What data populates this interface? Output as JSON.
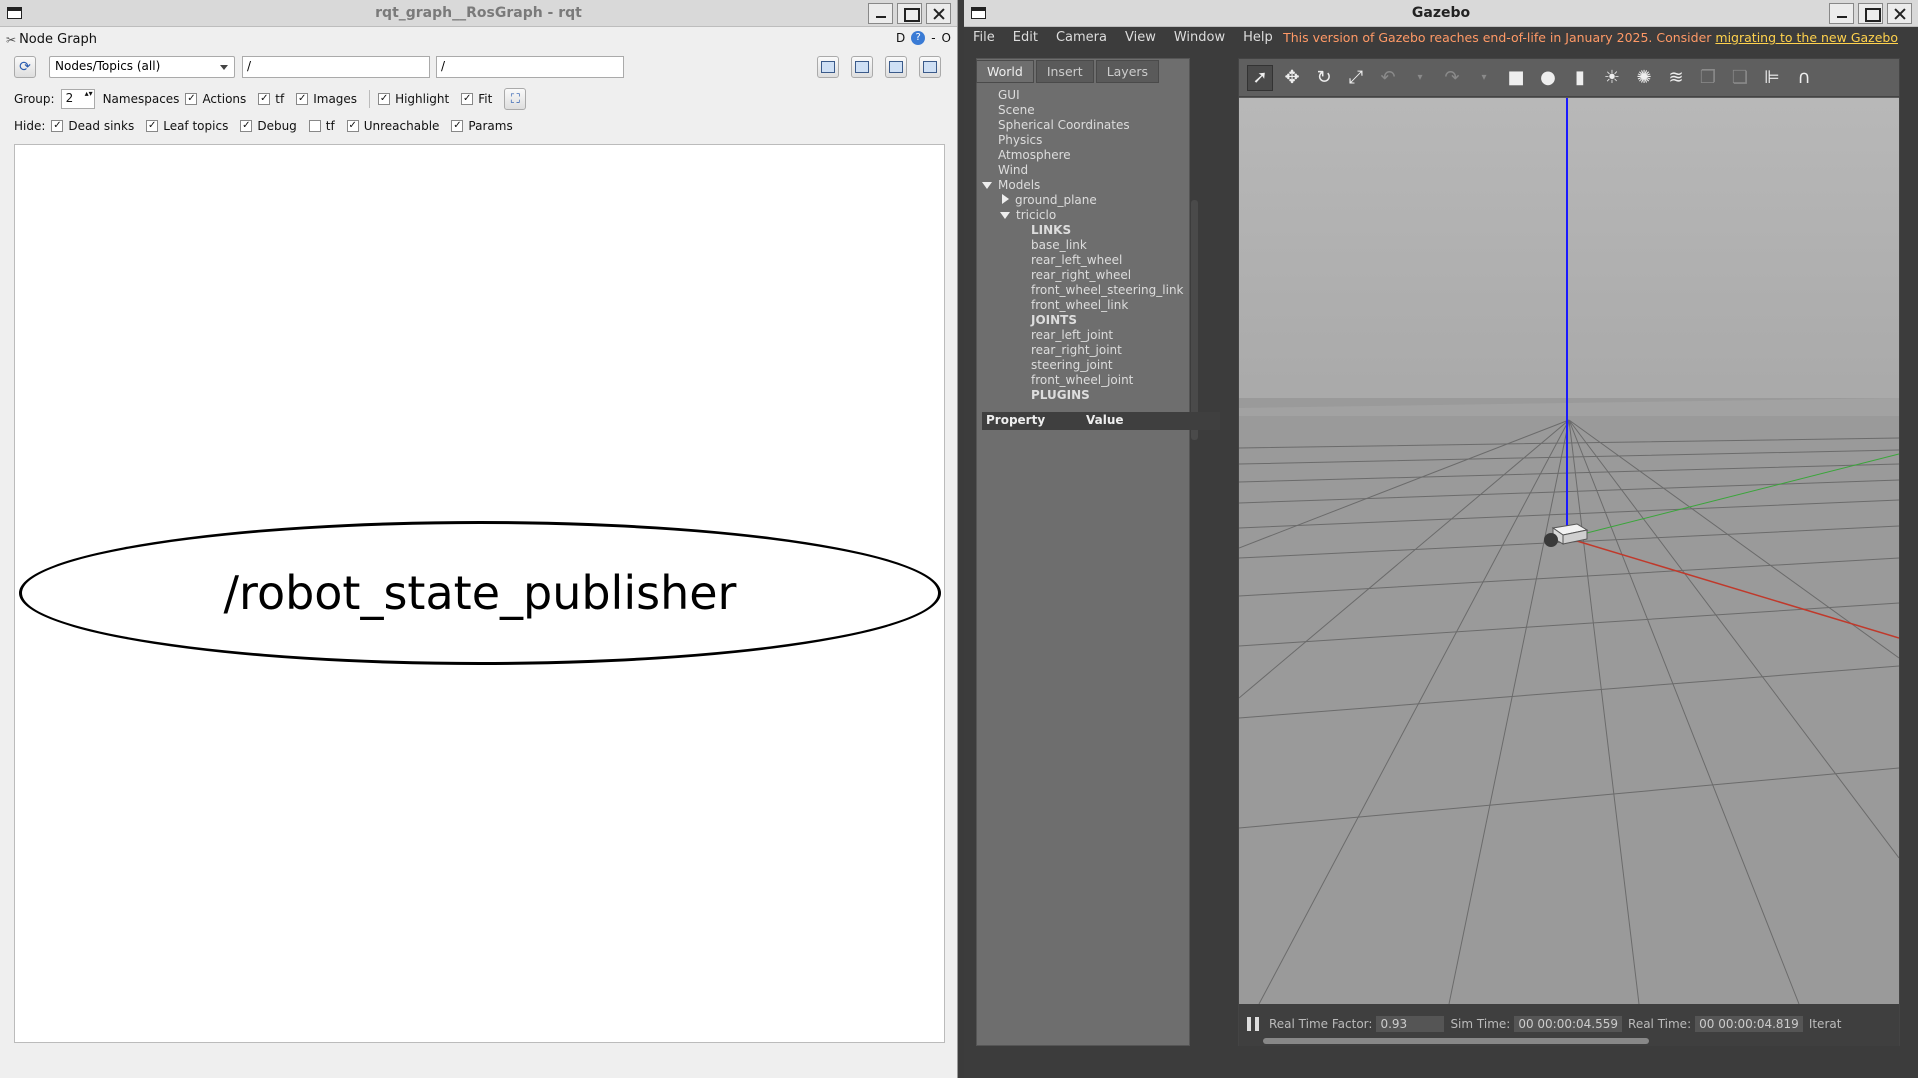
{
  "rqt": {
    "window_title": "rqt_graph__RosGraph - rqt",
    "plugin_title": "Node Graph",
    "plugin_right": [
      "D",
      "-",
      "O"
    ],
    "mode_combo": "Nodes/Topics (all)",
    "filter1": "/",
    "filter2": "/",
    "group_label": "Group:",
    "group_value": "2",
    "options_row": [
      "Namespaces",
      "Actions",
      "tf",
      "Images",
      "Highlight",
      "Fit"
    ],
    "hide_label": "Hide:",
    "hide_row": [
      "Dead sinks",
      "Leaf topics",
      "Debug",
      "tf",
      "Unreachable",
      "Params"
    ],
    "node_label": "/robot_state_publisher"
  },
  "gazebo": {
    "window_title": "Gazebo",
    "menu": [
      "File",
      "Edit",
      "Camera",
      "View",
      "Window",
      "Help"
    ],
    "eol_text": "This version of Gazebo reaches end-of-life in January 2025. Consider ",
    "eol_link": "migrating to the new Gazebo",
    "tabs": [
      "World",
      "Insert",
      "Layers"
    ],
    "tree": {
      "gui": "GUI",
      "scene": "Scene",
      "spherical": "Spherical Coordinates",
      "physics": "Physics",
      "atmosphere": "Atmosphere",
      "wind": "Wind",
      "models": "Models",
      "ground_plane": "ground_plane",
      "triciclo": "triciclo",
      "links_h": "LINKS",
      "links": [
        "base_link",
        "rear_left_wheel",
        "rear_right_wheel",
        "front_wheel_steering_link",
        "front_wheel_link"
      ],
      "joints_h": "JOINTS",
      "joints": [
        "rear_left_joint",
        "rear_right_joint",
        "steering_joint",
        "front_wheel_joint"
      ],
      "plugins_h": "PLUGINS"
    },
    "prop_head": [
      "Property",
      "Value"
    ],
    "rtf_label": "Real Time Factor:",
    "rtf_value": "0.93",
    "sim_label": "Sim Time:",
    "sim_value": "00 00:00:04.559",
    "real_label": "Real Time:",
    "real_value": "00 00:00:04.819",
    "iter_label": "Iterat"
  }
}
